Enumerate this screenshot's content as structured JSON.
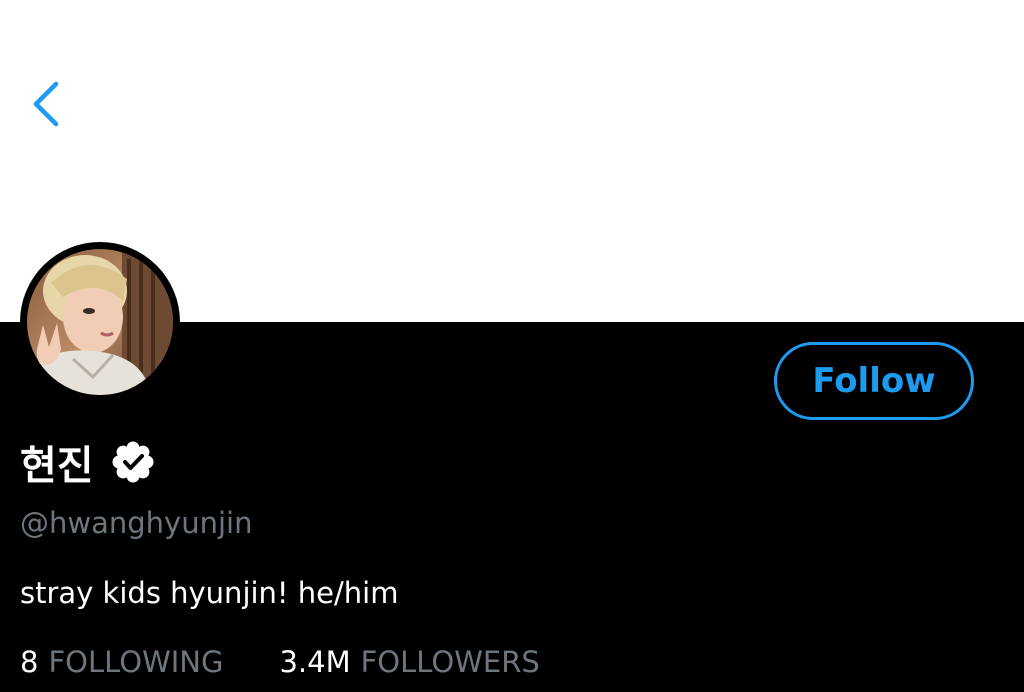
{
  "profile": {
    "display_name": "현진",
    "handle": "@hwanghyunjin",
    "bio": "stray kids hyunjin! he/him",
    "verified": true,
    "follow_label": "Follow",
    "stats": {
      "following_value": "8",
      "following_label": "FOLLOWING",
      "followers_value": "3.4M",
      "followers_label": "FOLLOWERS"
    }
  },
  "icons": {
    "back": "chevron-left-icon",
    "verified": "verified-badge-icon"
  },
  "colors": {
    "accent": "#1d9bf0",
    "background": "#000000",
    "banner": "#ffffff",
    "secondary_text": "#6e767d",
    "primary_text": "#ffffff"
  }
}
